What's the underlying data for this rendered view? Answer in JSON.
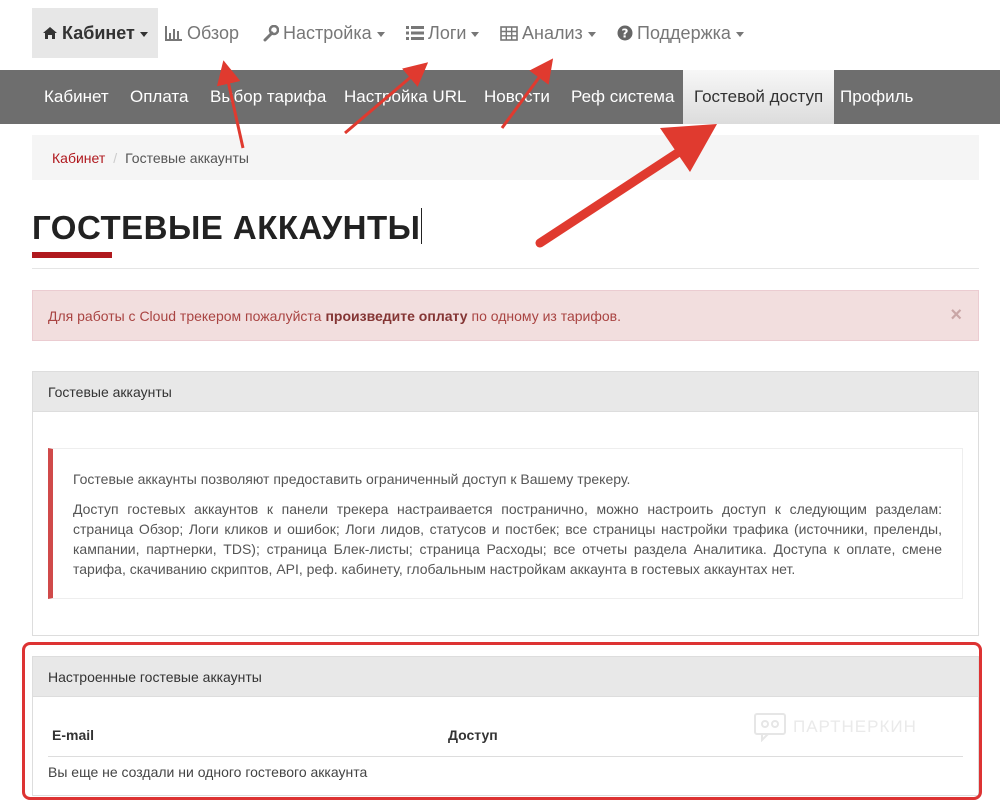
{
  "topnav": {
    "items": [
      {
        "label": "Кабинет"
      },
      {
        "label": "Обзор"
      },
      {
        "label": "Настройка"
      },
      {
        "label": "Логи"
      },
      {
        "label": "Анализ"
      },
      {
        "label": "Поддержка"
      }
    ]
  },
  "subnav": {
    "links": [
      {
        "label": "Кабинет"
      },
      {
        "label": "Оплата"
      },
      {
        "label": "Выбор тарифа"
      },
      {
        "label": "Настройка URL"
      },
      {
        "label": "Новости"
      },
      {
        "label": "Реф система"
      },
      {
        "label": "Гостевой доступ"
      },
      {
        "label": "Профиль"
      }
    ]
  },
  "breadcrumb": {
    "home": "Кабинет",
    "separator": "/",
    "current": "Гостевые аккаунты"
  },
  "page": {
    "title": "ГОСТЕВЫЕ АККАУНТЫ"
  },
  "alert": {
    "prefix": "Для работы с Cloud трекером пожалуйста",
    "link": "произведите оплату",
    "suffix": "по одному из тарифов.",
    "close": "×"
  },
  "panel_info": {
    "title": "Гостевые аккаунты",
    "p1": "Гостевые аккаунты позволяют предоставить ограниченный доступ к Вашему трекеру.",
    "p2": "Доступ гостевых аккаунтов к панели трекера настраивается постранично, можно настроить доступ к следующим разделам: страница Обзор; Логи кликов и ошибок; Логи лидов, статусов и постбек; все страницы настройки трафика (источники, преленды, кампании, партнерки, TDS); страница Блек-листы; страница Расходы; все отчеты раздела Аналитика. Доступа к оплате, смене тарифа, скачиванию скриптов, API, реф. кабинету, глобальным настройкам аккаунта в гостевых аккаунтах нет."
  },
  "panel_accounts": {
    "title": "Настроенные гостевые аккаунты",
    "columns": [
      "E-mail",
      "Доступ"
    ],
    "empty": "Вы еще не создали ни одного гостевого аккаунта"
  },
  "watermark": {
    "text": "ПАРТНЕРКИН"
  },
  "colors": {
    "accent": "#b0191e",
    "subnav_bg": "#6e6e6e",
    "annotation": "#e03a2f"
  }
}
